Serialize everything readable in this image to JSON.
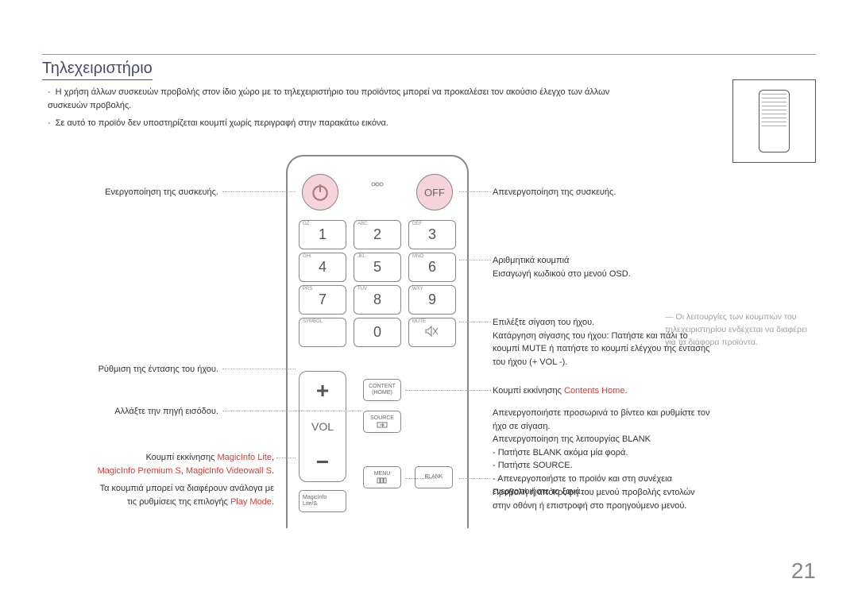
{
  "title": "Τηλεχειριστήριο",
  "notes": {
    "n1": "Η χρήση άλλων συσκευών προβολής στον ίδιο χώρο με το τηλεχειριστήριο του προϊόντος μπορεί να προκαλέσει τον ακούσιο έλεγχο των άλλων συσκευών προβολής.",
    "n2": "Σε αυτό το προϊόν δεν υποστηρίζεται κουμπί χωρίς περιγραφή στην παρακάτω εικόνα."
  },
  "remote": {
    "off": "OFF",
    "vol": "VOL",
    "keys": {
      "k1": {
        "num": "1",
        "sub": "OZ"
      },
      "k2": {
        "num": "2",
        "sub": "ABC"
      },
      "k3": {
        "num": "3",
        "sub": "DEF"
      },
      "k4": {
        "num": "4",
        "sub": "GHI"
      },
      "k5": {
        "num": "5",
        "sub": "JKL"
      },
      "k6": {
        "num": "6",
        "sub": "MNO"
      },
      "k7": {
        "num": "7",
        "sub": "PRS"
      },
      "k8": {
        "num": "8",
        "sub": "TUV"
      },
      "k9": {
        "num": "9",
        "sub": "WXY"
      },
      "ksym": {
        "num": "",
        "sub": "SYMBOL"
      },
      "k0": {
        "num": "0",
        "sub": ""
      },
      "kmute": {
        "num": "",
        "sub": "MUTE"
      }
    },
    "buttons": {
      "contentHome1": "CONTENT",
      "contentHome2": "(HOME)",
      "source": "SOURCE",
      "menu": "MENU",
      "blank": "BLANK",
      "magic1": "MagicInfo",
      "magic2": "Lite/S"
    }
  },
  "labels": {
    "l_power": "Ενεργοποίηση της συσκευής.",
    "l_vol": "Ρύθμιση της έντασης του ήχου.",
    "l_source": "Αλλάξτε την πηγή εισόδου.",
    "l_magic_pre": "Κουμπί εκκίνησης ",
    "l_magic_red1": "MagicInfo Lite",
    "l_magic_red2": "MagicInfo Premium S",
    "l_magic_red3": "MagicInfo Videowall S",
    "l_magic_sep": ", ",
    "l_magic_dot": ".",
    "l_magic_note1": "Τα κουμπιά μπορεί να διαφέρουν ανάλογα με",
    "l_magic_note2a": "τις ρυθμίσεις της επιλογής ",
    "l_magic_note2b": "Play Mode",
    "l_magic_note2c": ".",
    "r_off": "Απενεργοποίηση της συσκευής.",
    "r_num1": "Αριθμητικά κουμπιά",
    "r_num2": "Εισαγωγή κωδικού στο μενού OSD.",
    "r_mute1": "Επιλέξτε σίγαση του ήχου.",
    "r_mute2": "Κατάργηση σίγασης του ήχου: Πατήστε και πάλι το κουμπί MUTE ή πατήστε το κουμπί ελέγχου της έντασης του ήχου (+ VOL -).",
    "r_home_pre": "Κουμπί εκκίνησης ",
    "r_home_red": "Contents Home",
    "r_home_post": ".",
    "r_blank1": "Απενεργοποιήστε προσωρινά το βίντεο και ρυθμίστε τον ήχο σε σίγαση.",
    "r_blank2": "Απενεργοποίηση της λειτουργίας BLANK",
    "r_blank3": "- Πατήστε BLANK ακόμα μία φορά.",
    "r_blank4": "- Πατήστε SOURCE.",
    "r_blank5": "- Απενεργοποιήστε το προϊόν και στη συνέχεια ενεργοποιήστε το ξανά.",
    "r_menu": "Προβολή ή απόκρυψη του μενού προβολής εντολών στην οθόνη ή επιστροφή στο προηγούμενο μενού."
  },
  "sideNote": "Οι λειτουργίες των κουμπιών του τηλεχειριστηρίου ενδέχεται να διαφέρει για τα διάφορα προϊόντα.",
  "pageNumber": "21"
}
